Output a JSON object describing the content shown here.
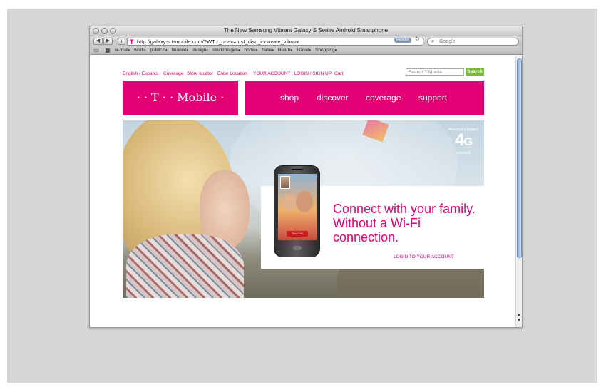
{
  "window": {
    "title": "The New Samsung Vibrant Galaxy S Series Android Smartphone"
  },
  "toolbar": {
    "back_label": "◀",
    "forward_label": "▶",
    "add_label": "+",
    "favicon": "T",
    "url": "http://galaxy-s.t-mobile.com/?WT.z_unav=mst_disc_innovate_vibrant",
    "reader_label": "Reader",
    "reload_icon": "↻",
    "search_icon": "⌕",
    "search_placeholder": "Google"
  },
  "bookmarks": {
    "icons": [
      "book-icon",
      "grid-icon"
    ],
    "items": [
      {
        "label": "e-mail",
        "dropdown": true
      },
      {
        "label": "work",
        "dropdown": true
      },
      {
        "label": "publicis",
        "dropdown": true
      },
      {
        "label": "finance",
        "dropdown": true
      },
      {
        "label": "design",
        "dropdown": true
      },
      {
        "label": "stockimages",
        "dropdown": true
      },
      {
        "label": "home",
        "dropdown": true
      },
      {
        "label": "base",
        "dropdown": true
      },
      {
        "label": "Heath",
        "dropdown": true
      },
      {
        "label": "Travel",
        "dropdown": true
      },
      {
        "label": "Shopping",
        "dropdown": true
      }
    ]
  },
  "site": {
    "utility_links": [
      "English / Espanol",
      "Coverage",
      "Store locator",
      "Enter Location",
      "YOUR ACCOUNT : LOGIN / SIGN UP",
      "Cart"
    ],
    "search_placeholder": "Search T-Mobile",
    "search_button": "Search",
    "logo_text": "· · T · · Mobile ·",
    "nav": [
      "shop",
      "discover",
      "coverage",
      "support"
    ],
    "hero": {
      "badge_top": "America's largest",
      "badge_main": "4",
      "badge_g": "G",
      "badge_bottom": "network",
      "headline": "Connect with your family. Without a Wi-Fi connection.",
      "login_link": "LOGIN TO YOUR ACCOUNT",
      "phone_button": "End Call"
    }
  },
  "colors": {
    "brand_magenta": "#e20074",
    "search_green": "#7ab83e"
  }
}
